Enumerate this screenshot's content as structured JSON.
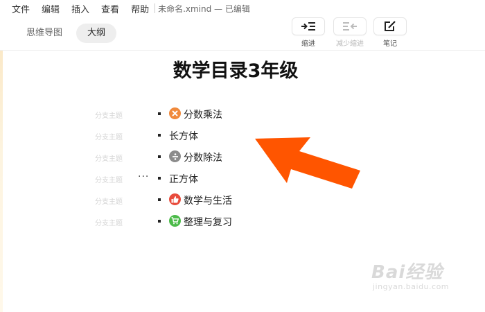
{
  "menu": {
    "items": [
      "文件",
      "编辑",
      "插入",
      "查看",
      "帮助"
    ],
    "doc_title": "未命名.xmind — 已编辑"
  },
  "view_tabs": [
    {
      "label": "思维导图",
      "active": false
    },
    {
      "label": "大纲",
      "active": true
    }
  ],
  "toolbar": {
    "indent_label": "缩进",
    "outdent_label": "减少缩进",
    "notes_label": "笔记"
  },
  "outline": {
    "title": "数学目录3年级",
    "ghost_label": "分支主题",
    "items": [
      {
        "label": "分数乘法",
        "icon": "multiply-icon",
        "icon_color": "#f08a3c"
      },
      {
        "label": "长方体",
        "icon": null
      },
      {
        "label": "分数除法",
        "icon": "divide-icon",
        "icon_color": "#8c8c8c"
      },
      {
        "label": "正方体",
        "icon": null
      },
      {
        "label": "数学与生活",
        "icon": "thumbs-up-icon",
        "icon_color": "#e84c3d"
      },
      {
        "label": "整理与复习",
        "icon": "cart-icon",
        "icon_color": "#4cbb4a"
      }
    ]
  },
  "colors": {
    "arrow": "#ff5500"
  },
  "watermark": {
    "main": "Bai经验",
    "sub": "jingyan.baidu.com"
  }
}
